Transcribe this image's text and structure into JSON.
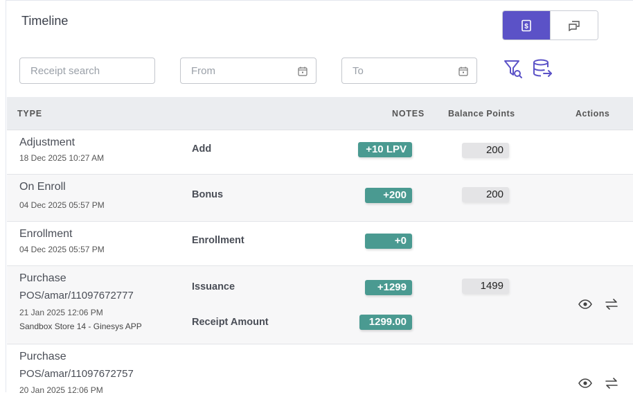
{
  "header": {
    "title": "Timeline"
  },
  "toolbar": {
    "receipt_placeholder": "Receipt search",
    "from_placeholder": "From",
    "to_placeholder": "To"
  },
  "colors": {
    "accent": "#5b52c7",
    "badge": "#4a9a91",
    "balance": "#e4e4e6"
  },
  "table": {
    "headers": {
      "type": "TYPE",
      "notes": "NOTES",
      "balance": "Balance Points",
      "actions": "Actions"
    },
    "rows": [
      {
        "type": "Adjustment",
        "date": "18 Dec 2025 10:27 AM",
        "note": "Add",
        "points": "+10 LPV",
        "balance": "200"
      },
      {
        "type": "On Enroll",
        "date": "04 Dec 2025 05:57 PM",
        "note": "Bonus",
        "points": "+200",
        "balance": "200"
      },
      {
        "type": "Enrollment",
        "date": "04 Dec 2025 05:57 PM",
        "note": "Enrollment",
        "points": "+0"
      },
      {
        "type": "Purchase",
        "receipt": "POS/amar/11097672777",
        "date": "21 Jan 2025 12:06 PM",
        "store": "Sandbox Store 14 - Ginesys APP",
        "note": "Issuance",
        "points": "+1299",
        "balance": "1499",
        "note2": "Receipt Amount",
        "amount": "1299.00"
      },
      {
        "type": "Purchase",
        "receipt": "POS/amar/11097672757",
        "date": "20 Jan 2025 12:06 PM"
      }
    ]
  }
}
